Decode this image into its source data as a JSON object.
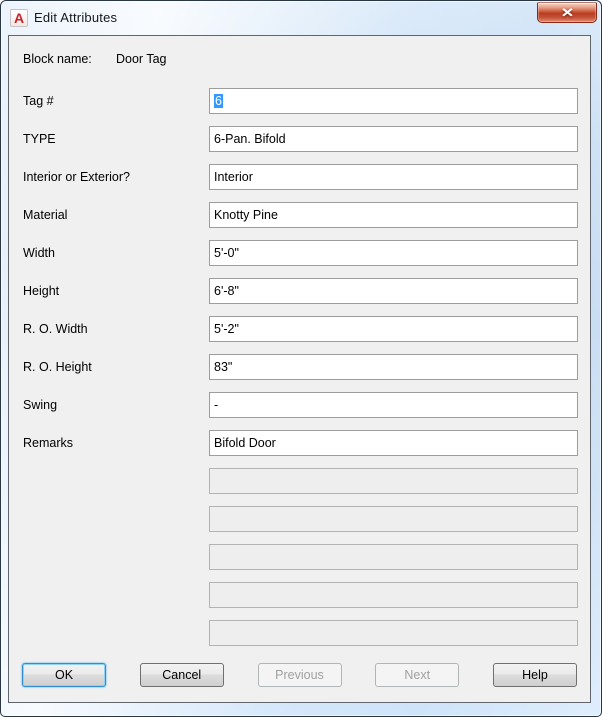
{
  "window": {
    "title": "Edit Attributes"
  },
  "icons": {
    "app_logo_glyph": "A",
    "close_glyph": "✕"
  },
  "header": {
    "block_name_label": "Block name:",
    "block_name_value": "Door Tag"
  },
  "fields": [
    {
      "label": "Tag #",
      "value": "6",
      "state": "selected"
    },
    {
      "label": "TYPE",
      "value": "6-Pan. Bifold",
      "state": "normal"
    },
    {
      "label": "Interior or Exterior?",
      "value": "Interior",
      "state": "normal"
    },
    {
      "label": "Material",
      "value": "Knotty Pine",
      "state": "normal"
    },
    {
      "label": "Width",
      "value": "5'-0\"",
      "state": "normal"
    },
    {
      "label": "Height",
      "value": "6'-8\"",
      "state": "normal"
    },
    {
      "label": "R. O. Width",
      "value": "5'-2\"",
      "state": "normal"
    },
    {
      "label": "R. O. Height",
      "value": "83\"",
      "state": "normal"
    },
    {
      "label": "Swing",
      "value": "-",
      "state": "normal"
    },
    {
      "label": "Remarks",
      "value": "Bifold Door",
      "state": "normal"
    },
    {
      "label": "",
      "value": "",
      "state": "disabled"
    },
    {
      "label": "",
      "value": "",
      "state": "disabled"
    },
    {
      "label": "",
      "value": "",
      "state": "disabled"
    },
    {
      "label": "",
      "value": "",
      "state": "disabled"
    },
    {
      "label": "",
      "value": "",
      "state": "disabled"
    }
  ],
  "buttons": [
    {
      "label": "OK",
      "state": "default"
    },
    {
      "label": "Cancel",
      "state": "normal"
    },
    {
      "label": "Previous",
      "state": "disabled"
    },
    {
      "label": "Next",
      "state": "disabled"
    },
    {
      "label": "Help",
      "state": "normal"
    }
  ],
  "colors": {
    "titlebar_blue": "#c2dbf4",
    "client_bg": "#f0f0f0",
    "selection_blue": "#3399ff",
    "close_button_red": "#c14a2e",
    "default_button_ring": "#2f8ecb",
    "app_logo_red": "#c2262c"
  }
}
